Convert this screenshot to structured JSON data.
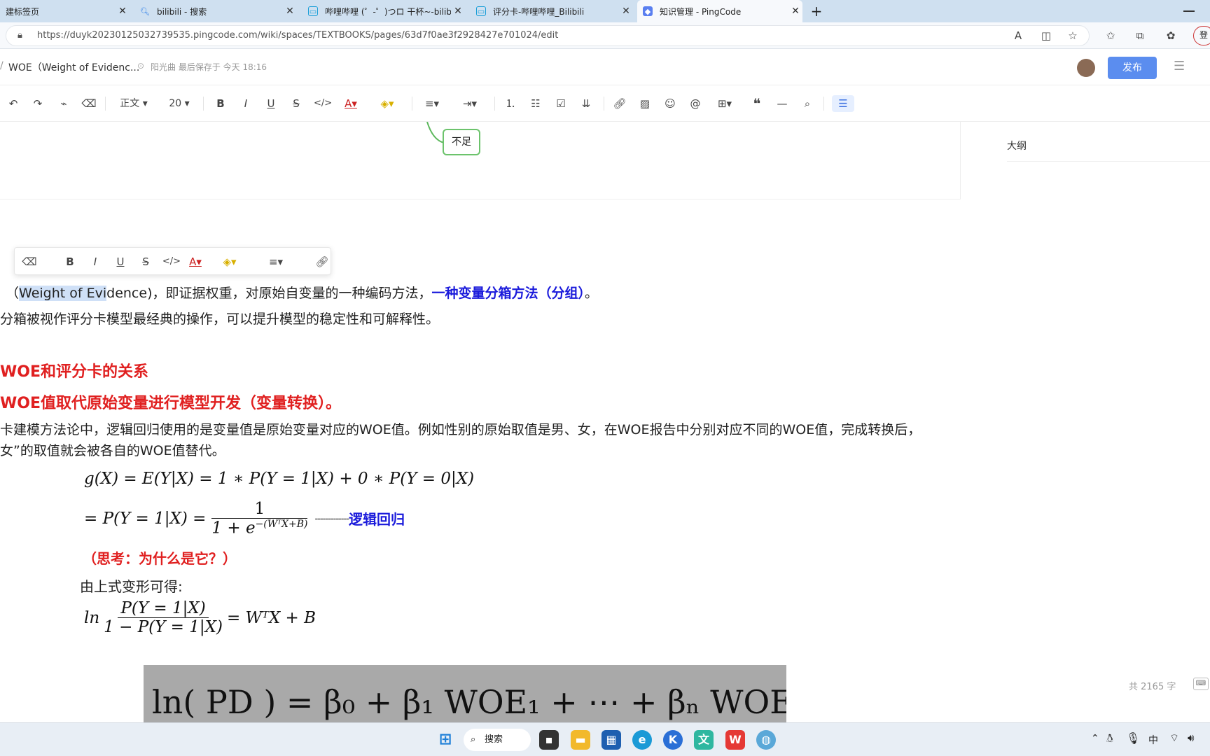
{
  "tabs": [
    {
      "title": "建标签页",
      "icon": "page-icon",
      "active": false
    },
    {
      "title": "bilibili - 搜索",
      "icon": "search-icon",
      "active": false
    },
    {
      "title": "哔哩哔哩 (゜-゜)つロ 干杯~-bilibili",
      "icon": "bilibili-icon",
      "active": false
    },
    {
      "title": "评分卡-哔哩哔哩_Bilibili",
      "icon": "bilibili-icon",
      "active": false
    },
    {
      "title": "知识管理 - PingCode",
      "icon": "pingcode-icon",
      "active": true
    }
  ],
  "new_tab": "+",
  "address": {
    "url": "https://duyk20230125032739535.pingcode.com/wiki/spaces/TEXTBOOKS/pages/63d7f0ae3f2928427e701024/edit",
    "login": "登"
  },
  "doc": {
    "title": "WOE（Weight of Evidenc...",
    "save_status": "阳光曲 最后保存于 今天 18:16",
    "publish": "发布"
  },
  "toolbar": {
    "style": "正文",
    "size": "20"
  },
  "outline": {
    "label": "大纲",
    "word_count": "共 2165 字"
  },
  "mindmap_node": "不足",
  "content": {
    "p1a": "（",
    "p1sel": "Weight of Evi",
    "p1b": "dence)，即证据权重，对原始自变量的一种编码方法，",
    "p1blue": "一种变量分箱方法（分组）",
    "p1end": "。",
    "p2": "分箱被视作评分卡模型最经典的操作，可以提升模型的稳定性和可解释性。",
    "h1": "WOE和评分卡的关系",
    "h2": "WOE值取代原始变量进行模型开发（变量转换）。",
    "p3": "卡建模方法论中，逻辑回归使用的是变量值是原始变量对应的WOE值。例如性别的原始取值是男、女，在WOE报告中分别对应不同的WOE值，完成转换后，",
    "p4": "女”的取值就会被各自的WOE值替代。",
    "eq1": "g(X) = E(Y|X) = 1 ∗ P(Y = 1|X) + 0 ∗ P(Y = 0|X)",
    "eq2_lhs": "= P(Y = 1|X) =",
    "eq2_num": "1",
    "eq2_den": "1 + e",
    "eq2_exp": "−(WᵀX+B)",
    "eq2_dash": "-------------",
    "eq2_note": "逻辑回归",
    "think": "（思考：为什么是它？）",
    "derive": "由上式变形可得:",
    "eq3_ln": "ln",
    "eq3_num": "P(Y = 1|X)",
    "eq3_den": "1 − P(Y = 1|X)",
    "eq3_rhs": "= WᵀX + B",
    "img_text": "ln( PD ) = β₀ + β₁ WOE₁ + ⋯ + βₙ WOE"
  },
  "taskbar": {
    "search": "搜索",
    "lang": "中"
  }
}
